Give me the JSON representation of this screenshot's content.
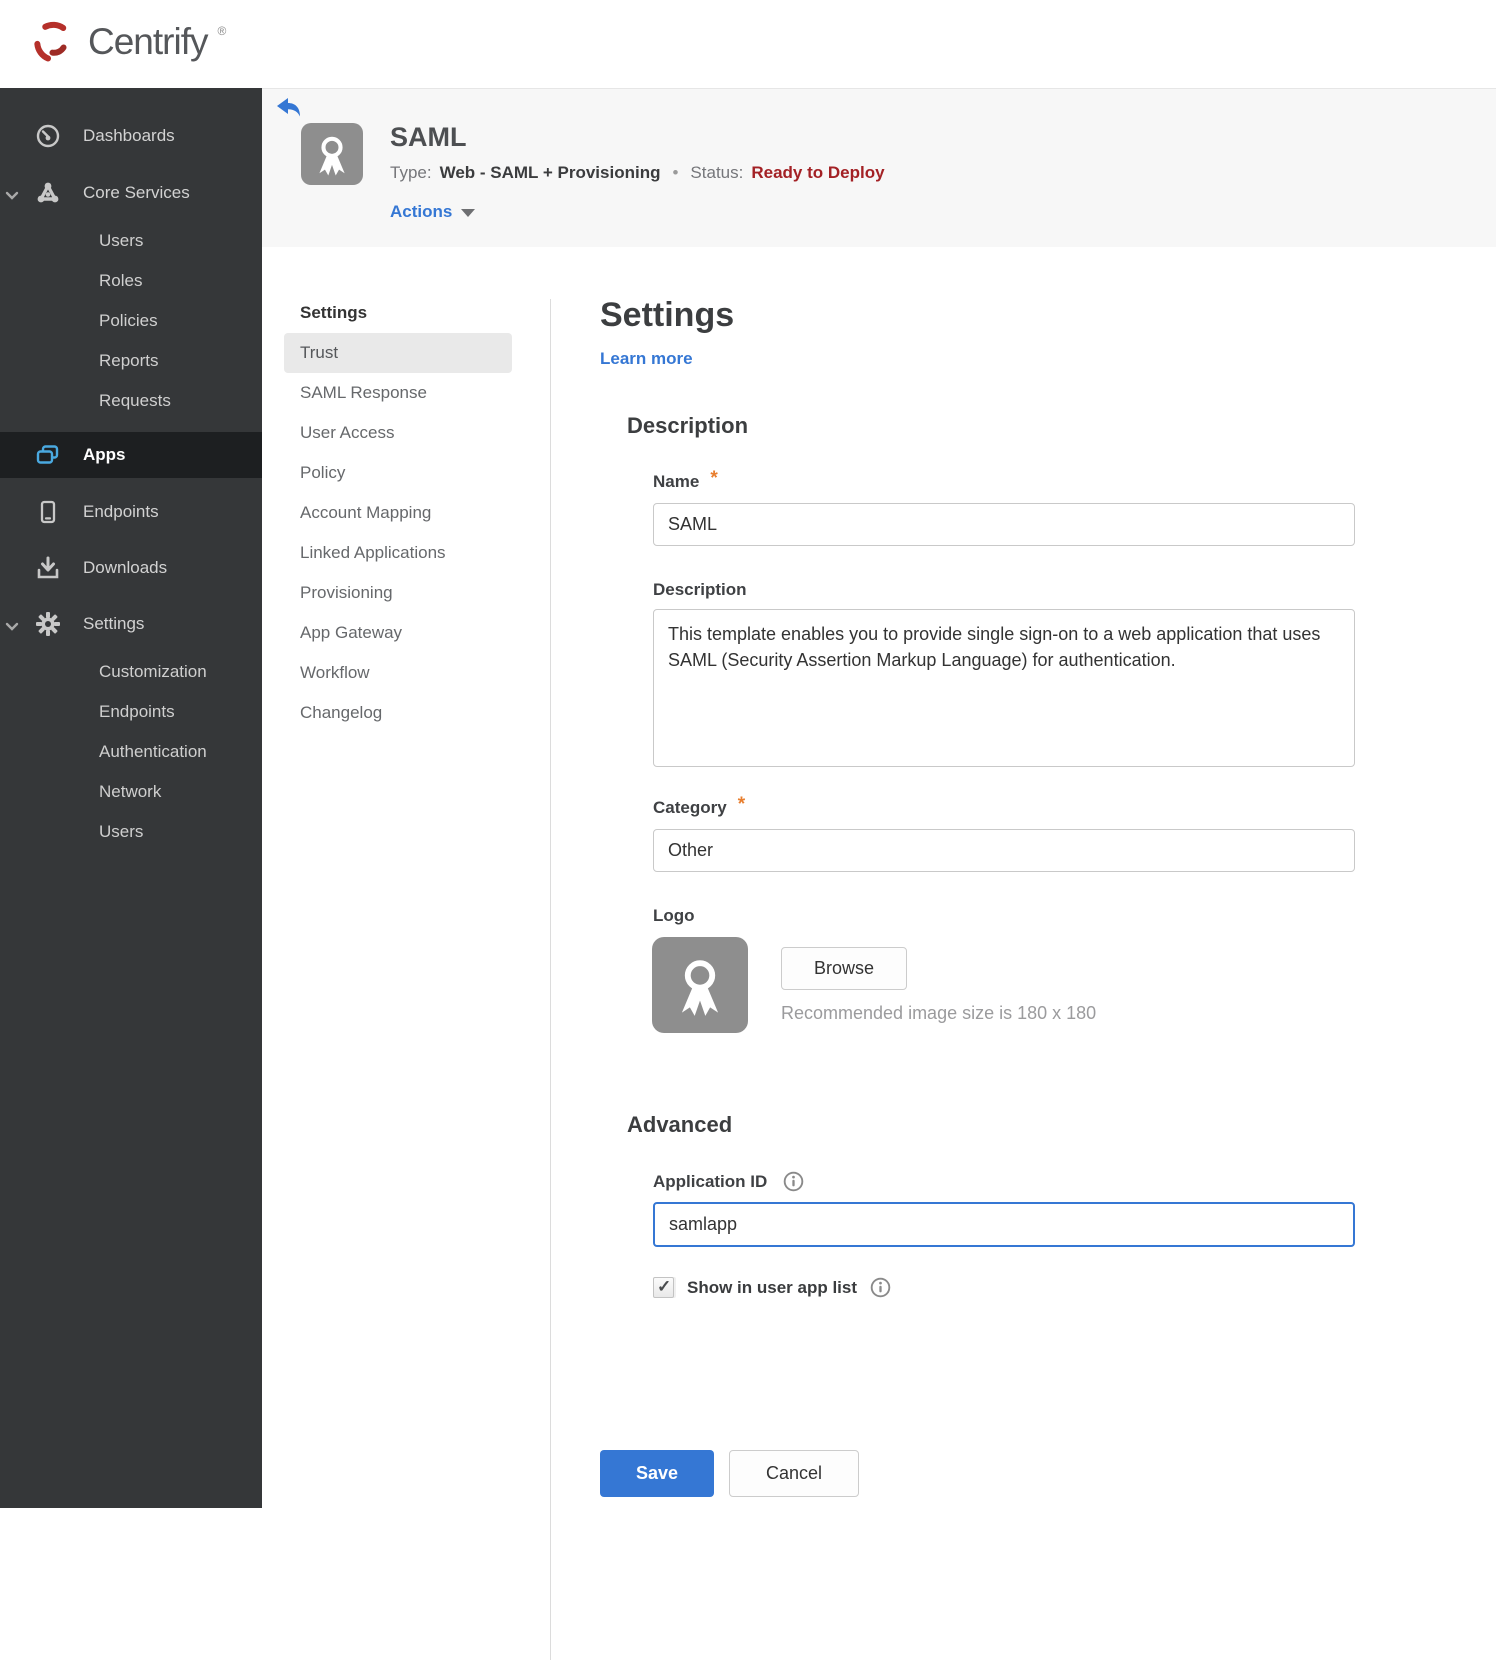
{
  "brand": {
    "name": "Centrify",
    "registered": "®"
  },
  "sidebar": {
    "items": [
      {
        "label": "Dashboards"
      },
      {
        "label": "Core Services",
        "expanded": true,
        "children": [
          {
            "label": "Users"
          },
          {
            "label": "Roles"
          },
          {
            "label": "Policies"
          },
          {
            "label": "Reports"
          },
          {
            "label": "Requests"
          }
        ]
      },
      {
        "label": "Apps",
        "active": true
      },
      {
        "label": "Endpoints"
      },
      {
        "label": "Downloads"
      },
      {
        "label": "Settings",
        "expanded": true,
        "children": [
          {
            "label": "Customization"
          },
          {
            "label": "Endpoints"
          },
          {
            "label": "Authentication"
          },
          {
            "label": "Network"
          },
          {
            "label": "Users"
          }
        ]
      }
    ]
  },
  "header": {
    "title": "SAML",
    "type_label": "Type:",
    "type_value": "Web - SAML + Provisioning",
    "separator": "•",
    "status_label": "Status:",
    "status_value": "Ready to Deploy",
    "actions_label": "Actions"
  },
  "subnav": {
    "section": "Settings",
    "items": [
      {
        "label": "Trust",
        "active": true
      },
      {
        "label": "SAML Response"
      },
      {
        "label": "User Access"
      },
      {
        "label": "Policy"
      },
      {
        "label": "Account Mapping"
      },
      {
        "label": "Linked Applications"
      },
      {
        "label": "Provisioning"
      },
      {
        "label": "App Gateway"
      },
      {
        "label": "Workflow"
      },
      {
        "label": "Changelog"
      }
    ]
  },
  "content": {
    "heading": "Settings",
    "learn_more": "Learn more",
    "description_section": {
      "title": "Description",
      "name_label": "Name",
      "required_marker": "*",
      "name_value": "SAML",
      "description_label": "Description",
      "description_value": "This template enables you to provide single sign-on to a web application that uses SAML (Security Assertion Markup Language) for authentication.",
      "category_label": "Category",
      "category_value": "Other",
      "logo_label": "Logo",
      "browse_label": "Browse",
      "size_hint": "Recommended image size is 180 x 180"
    },
    "advanced_section": {
      "title": "Advanced",
      "application_id_label": "Application ID",
      "application_id_value": "samlapp",
      "show_in_user_app_list_label": "Show in user app list",
      "checkbox_checked": true
    },
    "actions": {
      "save": "Save",
      "cancel": "Cancel"
    }
  },
  "colors": {
    "accent_blue": "#3577d4",
    "status_red": "#a32125",
    "asterisk_orange": "#e87e2e",
    "brand_red": "#b5302a",
    "sidebar_bg": "#353739",
    "sidebar_active_bg": "#1d1f21",
    "apps_icon_blue": "#4aa9e0"
  }
}
